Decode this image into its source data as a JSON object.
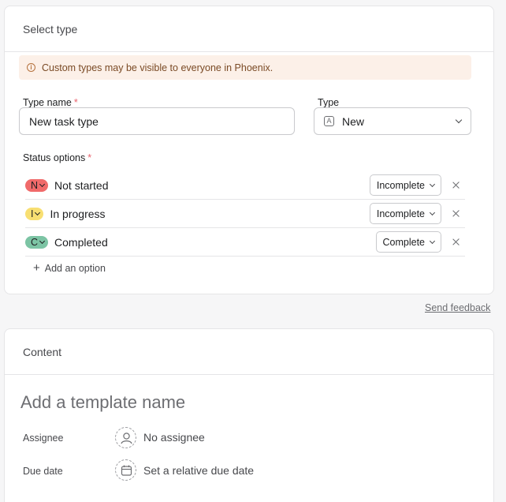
{
  "select_type": {
    "title": "Select type",
    "banner": "Custom types may be visible to everyone in Phoenix.",
    "type_name_label": "Type name",
    "type_name_value": "New task type",
    "type_label": "Type",
    "type_value": "New",
    "type_icon": "A",
    "status_options_label": "Status options",
    "required_mark": "*",
    "statuses": [
      {
        "letter": "N",
        "label": "Not started",
        "state": "Incomplete",
        "color": "#f06a6a"
      },
      {
        "letter": "I",
        "label": "In progress",
        "state": "Incomplete",
        "color": "#f8df72"
      },
      {
        "letter": "C",
        "label": "Completed",
        "state": "Complete",
        "color": "#5da283"
      }
    ],
    "add_option": "Add an option"
  },
  "feedback": "Send feedback",
  "content": {
    "title": "Content",
    "template_name_placeholder": "Add a template name",
    "assignee_label": "Assignee",
    "assignee_value": "No assignee",
    "due_date_label": "Due date",
    "due_date_value": "Set a relative due date"
  }
}
